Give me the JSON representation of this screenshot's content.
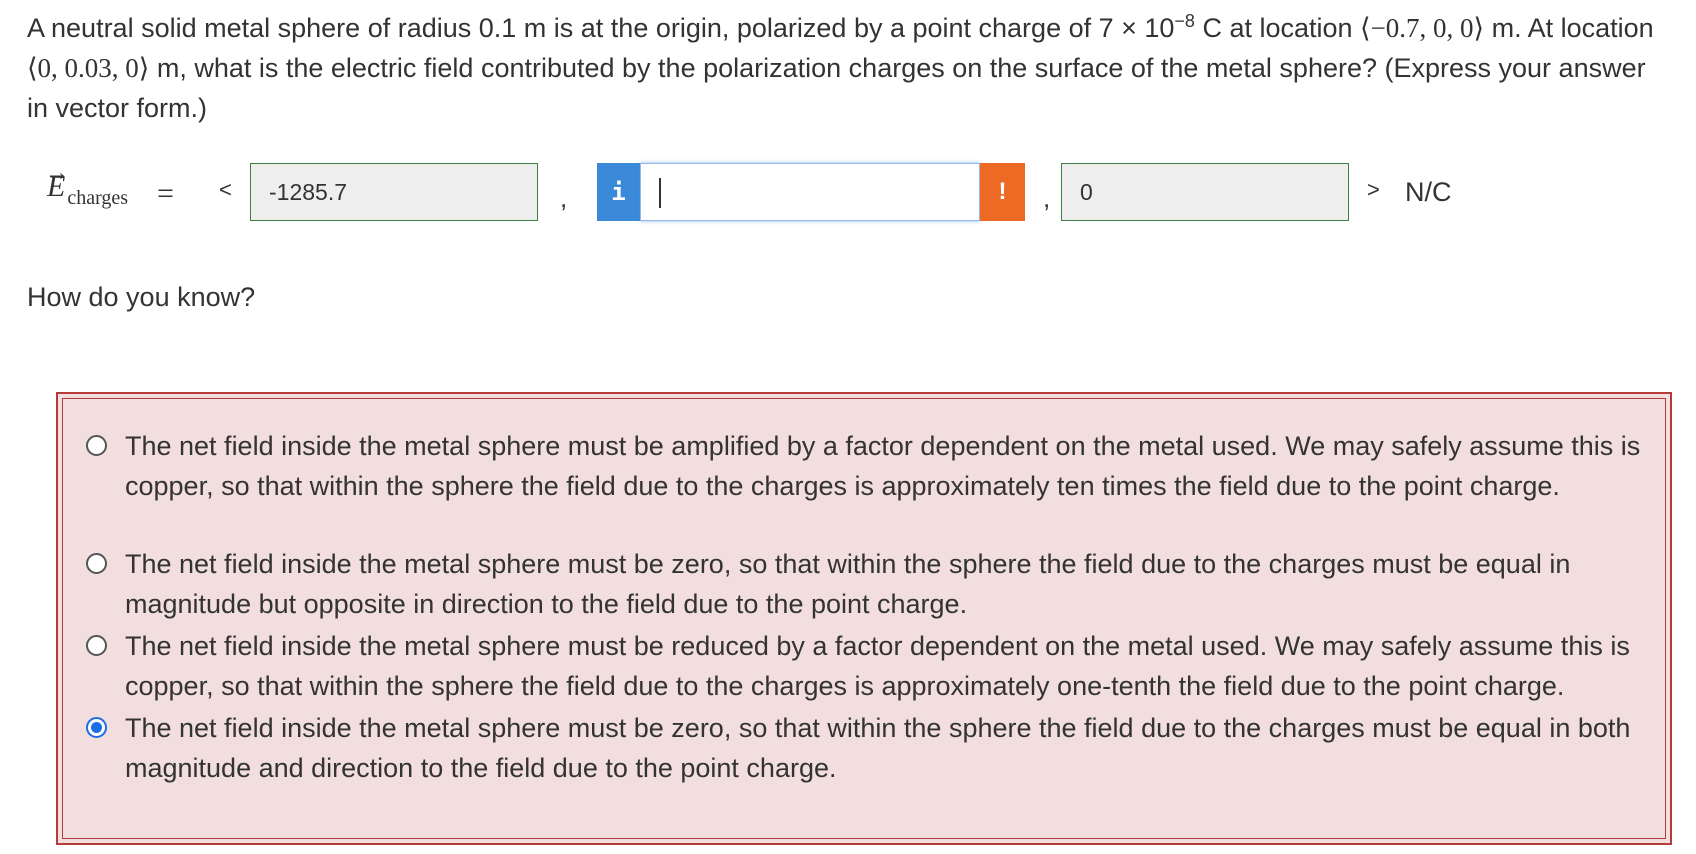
{
  "question": {
    "text_before_sup": "A neutral solid metal sphere of radius 0.1 m is at the origin, polarized by a point charge of 7 × 10",
    "exponent": "−8",
    "text_after_sup": " C at location ",
    "charge_location": "⟨−0.7, 0, 0⟩",
    "text_mid": " m. At location ",
    "field_location": "⟨0, 0.03, 0⟩",
    "text_end": " m, what is the electric field contributed by the polarization charges on the surface of the metal sphere? (Express your answer in vector form.)"
  },
  "answer_row": {
    "vector_symbol": "E",
    "arrow": "→",
    "subscript": "charges",
    "equals": "=",
    "open_bracket": "<",
    "close_bracket": ">",
    "comma": ",",
    "x_value": "-1285.7",
    "y_value": "",
    "z_value": "0",
    "info_badge": "i",
    "warning_badge": "!",
    "unit": "N/C",
    "colors": {
      "correct_border": "#3f7f3f",
      "info": "#3b8ad9",
      "warning": "#ec6a24"
    }
  },
  "how_prompt": "How do you know?",
  "choices": {
    "box_color": "#f2dede",
    "border_color": "#b63a3a",
    "items": [
      {
        "label": "The net field inside the metal sphere must be amplified by a factor dependent on the metal used. We may safely assume this is copper, so that within the sphere the field due to the charges is approximately ten times the field due to the point charge.",
        "selected": false
      },
      {
        "label": "The net field inside the metal sphere must be zero, so that within the sphere the field due to the charges must be equal in magnitude but opposite in direction to the field due to the point charge.",
        "selected": false
      },
      {
        "label": "The net field inside the metal sphere must be reduced by a factor dependent on the metal used. We may safely assume this is copper, so that within the sphere the field due to the charges is approximately one-tenth the field due to the point charge.",
        "selected": false
      },
      {
        "label": "The net field inside the metal sphere must be zero, so that within the sphere the field due to the charges must be equal in both magnitude and direction to the field due to the point charge.",
        "selected": true
      }
    ]
  }
}
